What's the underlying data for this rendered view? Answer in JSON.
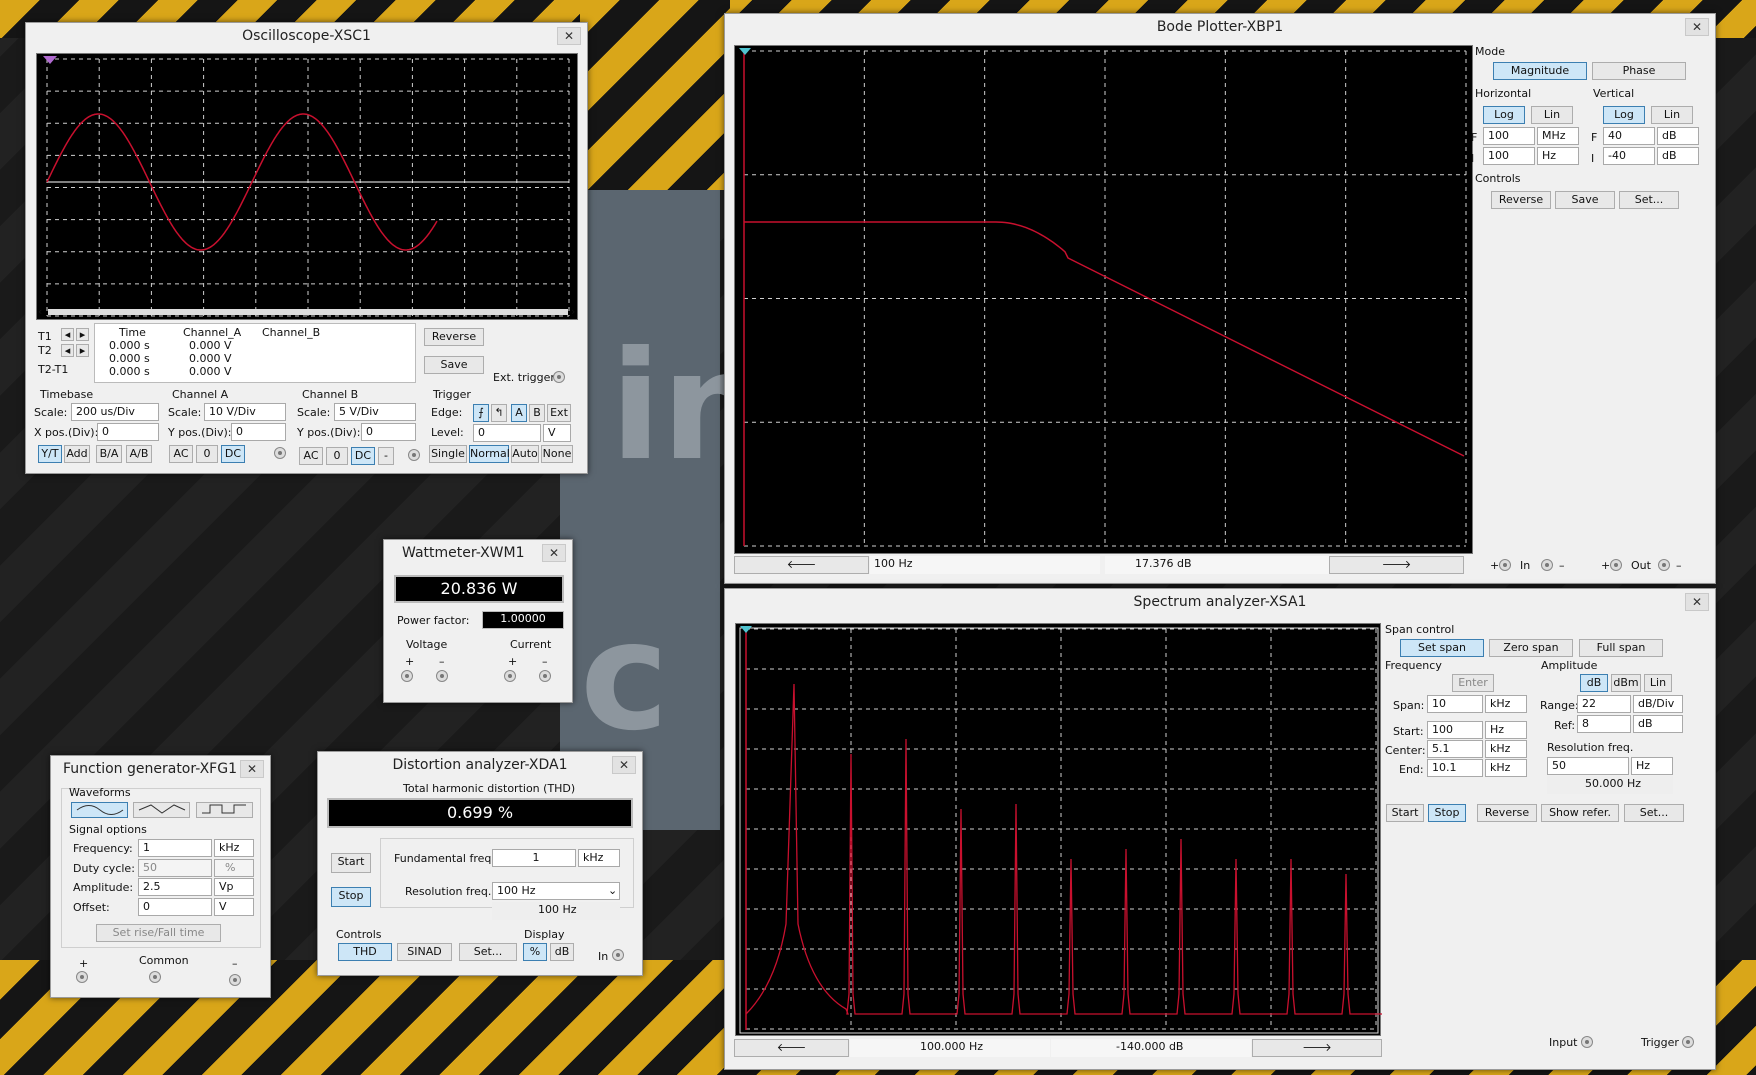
{
  "oscilloscope": {
    "title": "Oscilloscope-XSC1",
    "close": "✕",
    "cursor_headers": [
      "Time",
      "Channel_A",
      "Channel_B"
    ],
    "rows": [
      {
        "label": "T1",
        "time": "0.000 s",
        "a": "0.000 V"
      },
      {
        "label": "T2",
        "time": "0.000 s",
        "a": "0.000 V"
      },
      {
        "label": "T2-T1",
        "time": "0.000 s",
        "a": "0.000 V"
      }
    ],
    "reverse": "Reverse",
    "save": "Save",
    "ext_trigger": "Ext. trigger",
    "timebase": {
      "title": "Timebase",
      "scale_lbl": "Scale:",
      "scale": "200 us/Div",
      "xpos_lbl": "X pos.(Div):",
      "xpos": "0",
      "buttons": [
        "Y/T",
        "Add",
        "B/A",
        "A/B"
      ]
    },
    "channel_a": {
      "title": "Channel A",
      "scale_lbl": "Scale:",
      "scale": "10  V/Div",
      "ypos_lbl": "Y pos.(Div):",
      "ypos": "0",
      "buttons": [
        "AC",
        "0",
        "DC"
      ]
    },
    "channel_b": {
      "title": "Channel B",
      "scale_lbl": "Scale:",
      "scale": "5  V/Div",
      "ypos_lbl": "Y pos.(Div):",
      "ypos": "0",
      "buttons": [
        "AC",
        "0",
        "DC",
        "-"
      ]
    },
    "trigger": {
      "title": "Trigger",
      "edge_lbl": "Edge:",
      "edge_buttons": [
        "⨍",
        "↰",
        "A",
        "B",
        "Ext"
      ],
      "level_lbl": "Level:",
      "level": "0",
      "level_unit": "V",
      "modes": [
        "Single",
        "Normal",
        "Auto",
        "None"
      ]
    }
  },
  "bode": {
    "title": "Bode Plotter-XBP1",
    "close": "✕",
    "mode": "Mode",
    "magnitude": "Magnitude",
    "phase": "Phase",
    "horizontal": "Horizontal",
    "vertical": "Vertical",
    "log": "Log",
    "lin": "Lin",
    "h_f": "100",
    "h_f_unit": "MHz",
    "h_i": "100",
    "h_i_unit": "Hz",
    "f": "F",
    "i": "I",
    "v_f": "40",
    "v_f_unit": "dB",
    "v_i": "-40",
    "v_i_unit": "dB",
    "controls": "Controls",
    "reverse": "Reverse",
    "save": "Save",
    "set": "Set...",
    "readout_freq": "100  Hz",
    "readout_db": "17.376 dB",
    "in_label": "In",
    "out_label": "Out",
    "plus": "+",
    "minus": "–"
  },
  "spectrum": {
    "title": "Spectrum analyzer-XSA1",
    "close": "✕",
    "span_control": "Span control",
    "set_span": "Set span",
    "zero_span": "Zero span",
    "full_span": "Full span",
    "frequency": "Frequency",
    "enter": "Enter",
    "span_lbl": "Span:",
    "span": "10",
    "span_unit": "kHz",
    "start_lbl": "Start:",
    "start": "100",
    "start_unit": "Hz",
    "center_lbl": "Center:",
    "center": "5.1",
    "center_unit": "kHz",
    "end_lbl": "End:",
    "end": "10.1",
    "end_unit": "kHz",
    "amplitude": "Amplitude",
    "db": "dB",
    "dbm": "dBm",
    "lin": "Lin",
    "range_lbl": "Range:",
    "range": "22",
    "range_unit": "dB/Div",
    "ref_lbl": "Ref:",
    "ref": "8",
    "ref_unit": "dB",
    "res_freq": "Resolution freq.",
    "res_val": "50",
    "res_unit": "Hz",
    "res_display": "50.000  Hz",
    "start_btn": "Start",
    "stop_btn": "Stop",
    "reverse": "Reverse",
    "show_refer": "Show refer.",
    "set": "Set...",
    "readout_freq": "100.000  Hz",
    "readout_db": "-140.000  dB",
    "input": "Input",
    "trigger": "Trigger"
  },
  "wattmeter": {
    "title": "Wattmeter-XWM1",
    "close": "✕",
    "reading": "20.836 W",
    "pf_lbl": "Power factor:",
    "pf": "1.00000",
    "voltage": "Voltage",
    "current": "Current",
    "plus": "+",
    "minus": "–"
  },
  "funcgen": {
    "title": "Function generator-XFG1",
    "close": "✕",
    "waveforms": "Waveforms",
    "signal_options": "Signal options",
    "freq_lbl": "Frequency:",
    "freq": "1",
    "freq_unit": "kHz",
    "duty_lbl": "Duty cycle:",
    "duty": "50",
    "duty_unit": "%",
    "amp_lbl": "Amplitude:",
    "amp": "2.5",
    "amp_unit": "Vp",
    "off_lbl": "Offset:",
    "off": "0",
    "off_unit": "V",
    "set_rise": "Set rise/Fall time",
    "plus": "+",
    "common": "Common",
    "minus": "–"
  },
  "distortion": {
    "title": "Distortion analyzer-XDA1",
    "close": "✕",
    "thd_title": "Total harmonic distortion (THD)",
    "thd": "0.699 %",
    "start": "Start",
    "stop": "Stop",
    "fund_lbl": "Fundamental freq.",
    "fund": "1",
    "fund_unit": "kHz",
    "res_lbl": "Resolution freq.",
    "res": "100 Hz",
    "res_display": "100 Hz",
    "controls": "Controls",
    "display": "Display",
    "thd_btn": "THD",
    "sinad": "SINAD",
    "set": "Set...",
    "pct": "%",
    "db": "dB",
    "in": "In"
  },
  "colors": {
    "trace": "#c8102e",
    "screen": "#000000",
    "grid": "#cfcfcf"
  }
}
